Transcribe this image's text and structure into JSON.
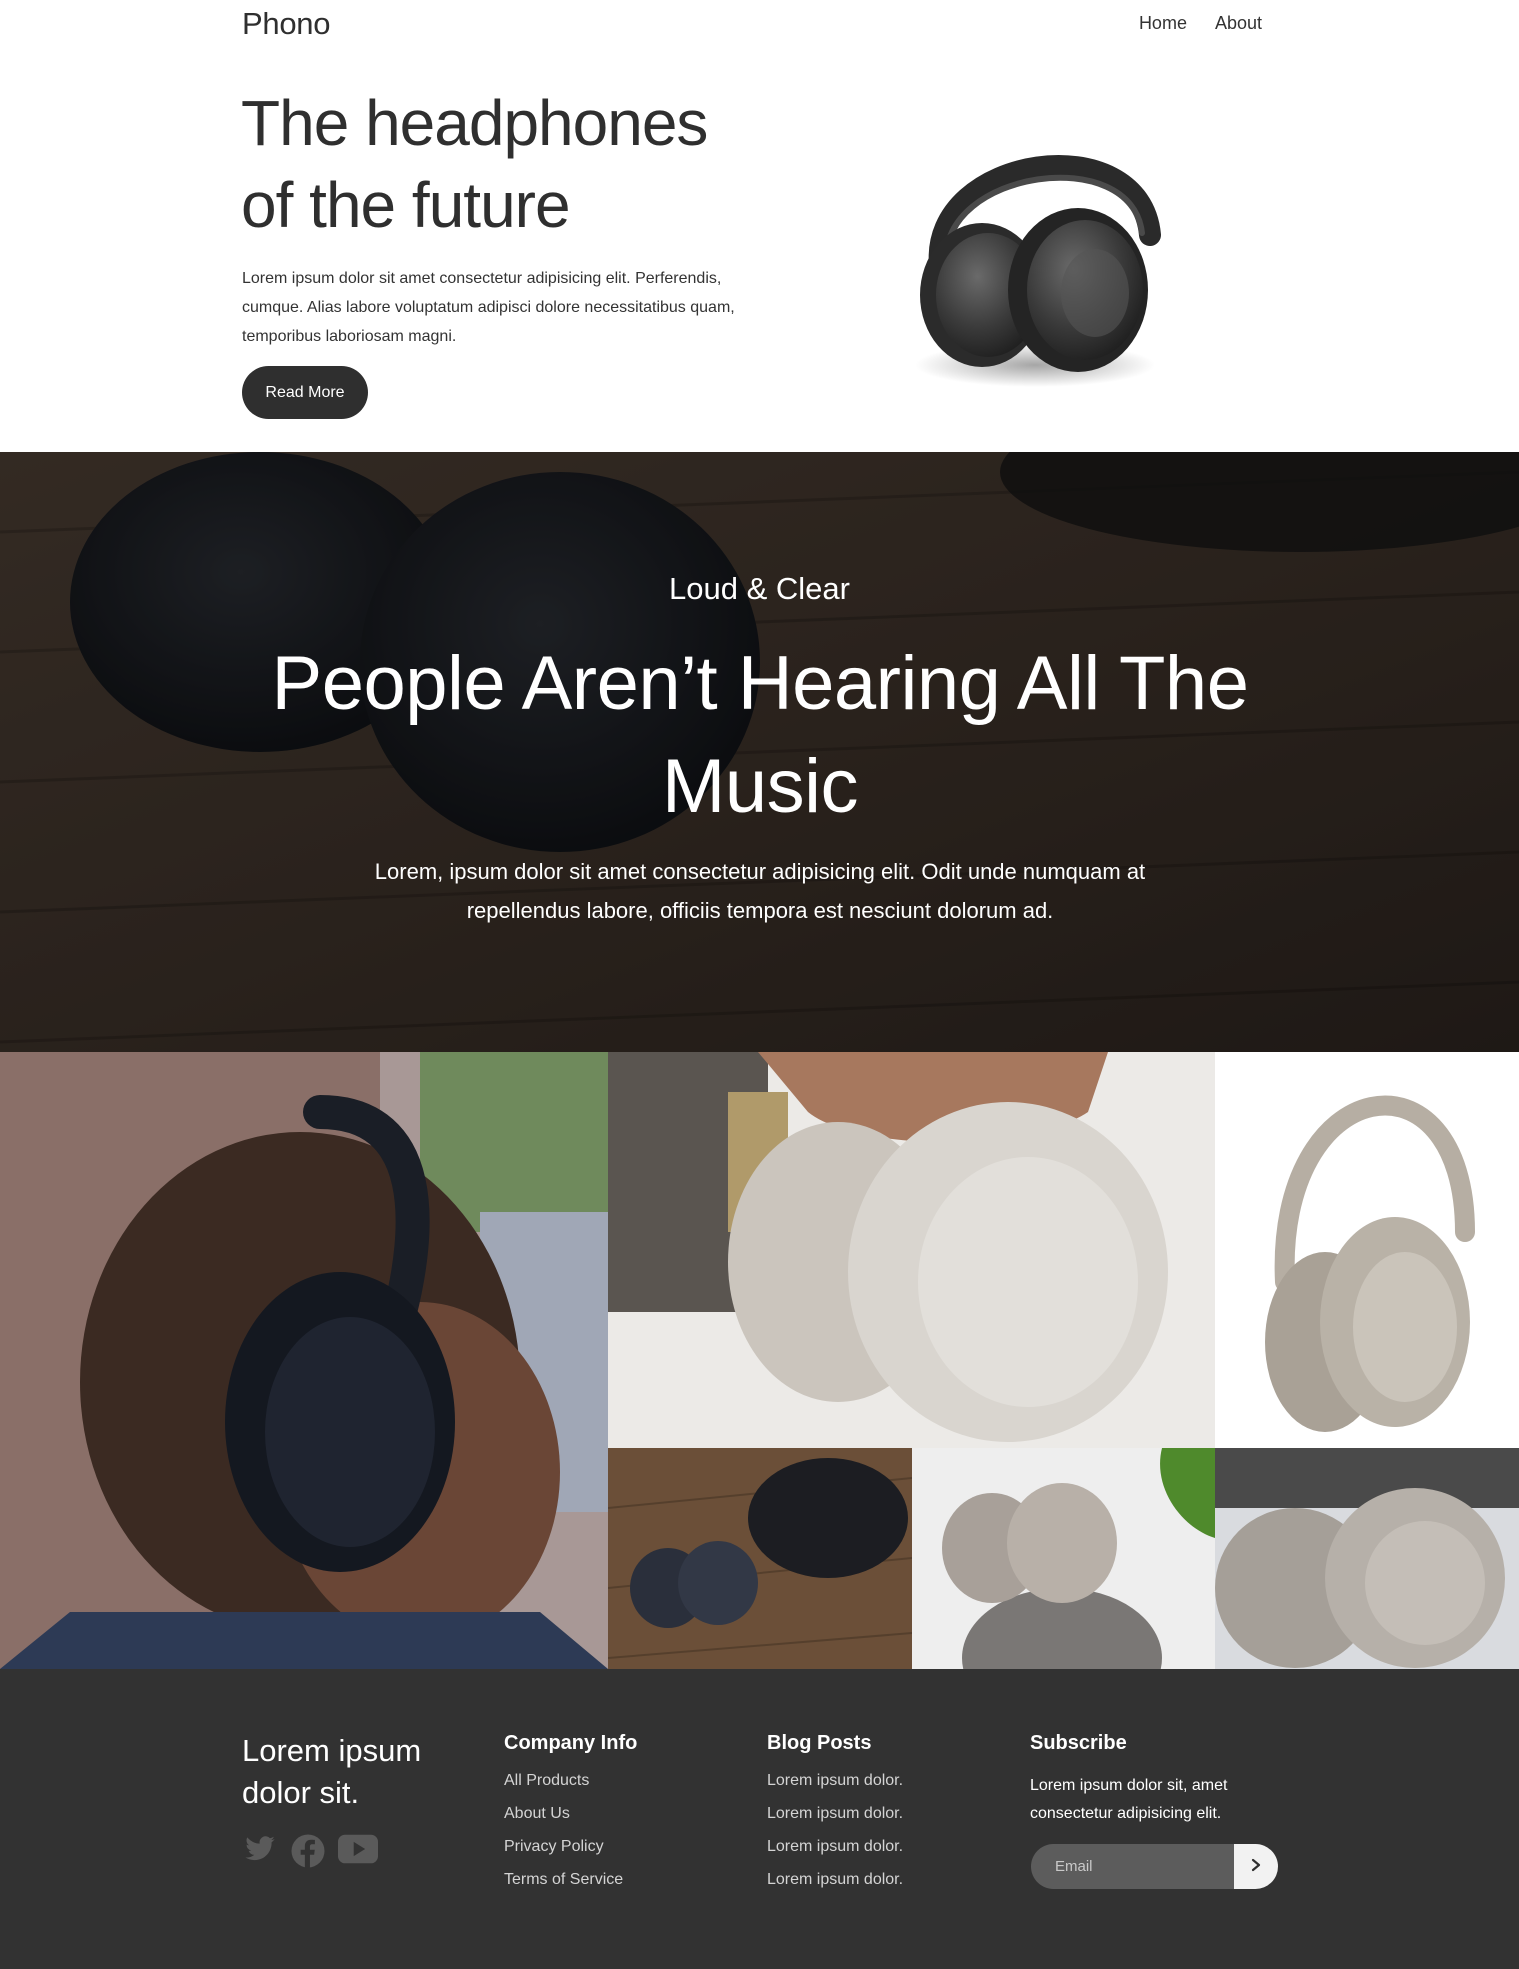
{
  "nav": {
    "brand": "Phono",
    "links": [
      "Home",
      "About"
    ]
  },
  "hero": {
    "title": "The headphones of the future",
    "text": "Lorem ipsum dolor sit amet consectetur adipisicing elit. Perferendis, cumque. Alias labore voluptatum adipisci dolore necessitatibus quam, temporibus laboriosam magni.",
    "button": "Read More",
    "image_icon": "headphones-image"
  },
  "banner": {
    "subtitle": "Loud & Clear",
    "title": "People Aren’t Hearing All The Music",
    "text": "Lorem, ipsum dolor sit amet consectetur adipisicing elit. Odit unde numquam at repellendus labore, officiis tempora est nesciunt dolorum ad."
  },
  "gallery": {
    "images": [
      "person-wearing-headphones-photo",
      "headphones-around-neck-photo",
      "silver-headphones-photo",
      "headphones-on-table-photo",
      "headphones-with-plant-photo",
      "headphones-closeup-photo"
    ]
  },
  "footer": {
    "tagline": "Lorem ipsum dolor sit.",
    "social_icons": [
      "twitter-icon",
      "facebook-icon",
      "youtube-icon"
    ],
    "company": {
      "heading": "Company Info",
      "links": [
        "All Products",
        "About Us",
        "Privacy Policy",
        "Terms of Service"
      ]
    },
    "blog": {
      "heading": "Blog Posts",
      "links": [
        "Lorem ipsum dolor.",
        "Lorem ipsum dolor.",
        "Lorem ipsum dolor.",
        "Lorem ipsum dolor."
      ]
    },
    "subscribe": {
      "heading": "Subscribe",
      "text": "Lorem ipsum dolor sit, amet consectetur adipisicing elit.",
      "placeholder": "Email",
      "button_icon": "chevron-right-icon"
    }
  },
  "colors": {
    "primary_dark": "#2f2f2f",
    "footer_bg": "#323232",
    "input_bg": "#5c5c5c"
  }
}
